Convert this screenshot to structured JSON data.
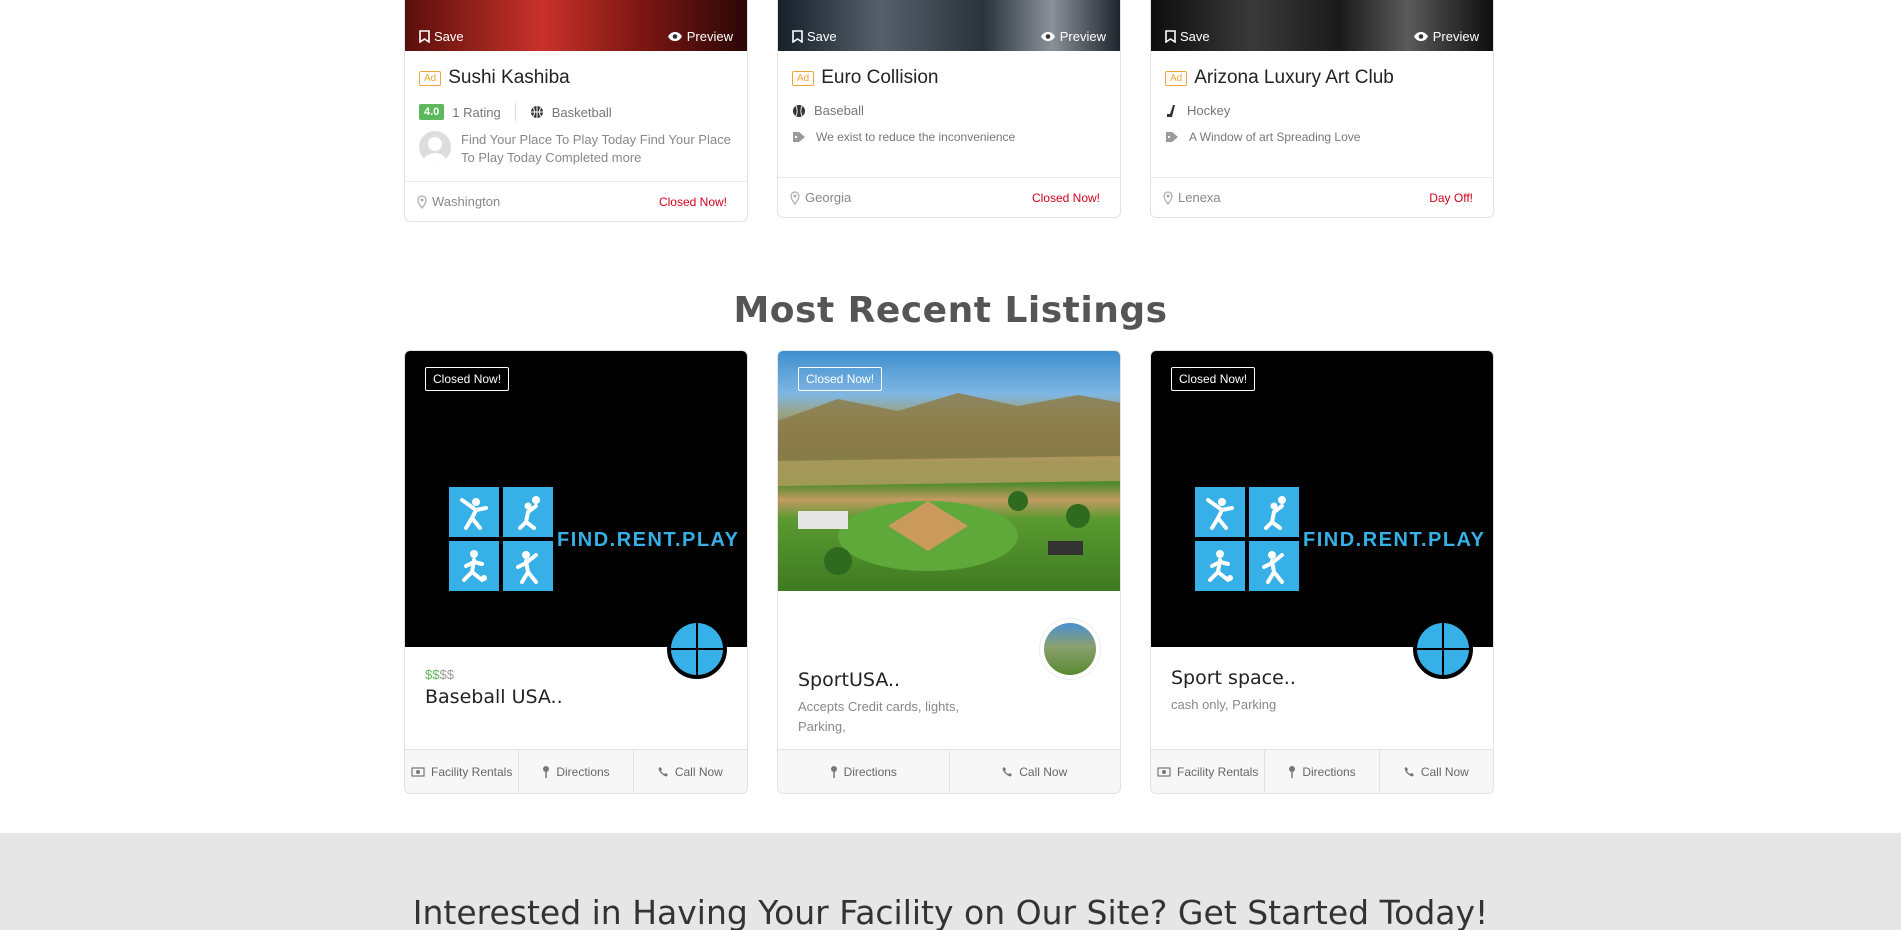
{
  "featured": [
    {
      "save_label": "Save",
      "preview_label": "Preview",
      "ad": "Ad",
      "title": "Sushi Kashiba",
      "rating": "4.0",
      "rating_count": "1 Rating",
      "category": "Basketball",
      "description": "Find Your Place To Play Today Find Your Place To Play Today Completed more",
      "location": "Washington",
      "status": "Closed Now!",
      "image_colors": [
        "#7a1612",
        "#c8322a"
      ]
    },
    {
      "save_label": "Save",
      "preview_label": "Preview",
      "ad": "Ad",
      "title": "Euro Collision",
      "category": "Baseball",
      "description": "We exist to reduce the inconvenience",
      "location": "Georgia",
      "status": "Closed Now!",
      "image_colors": [
        "#1c2630",
        "#6a7580"
      ]
    },
    {
      "save_label": "Save",
      "preview_label": "Preview",
      "ad": "Ad",
      "title": "Arizona Luxury Art Club",
      "category": "Hockey",
      "description": "A Window of art Spreading Love",
      "location": "Lenexa",
      "status": "Day Off!",
      "image_colors": [
        "#121212",
        "#4a4a4a"
      ]
    }
  ],
  "section_title": "Most Recent Listings",
  "recent": [
    {
      "badge": "Closed Now!",
      "logo_text": "FIND.RENT.PLAY",
      "price_active": "$$",
      "price_inactive": "$$",
      "title": "Baseball USA..",
      "tags": "",
      "actions": [
        "Facility Rentals",
        "Directions",
        "Call Now"
      ]
    },
    {
      "badge": "Closed Now!",
      "title": "SportUSA..",
      "tags": "Accepts Credit cards, lights, Parking,",
      "actions": [
        "Directions",
        "Call Now"
      ]
    },
    {
      "badge": "Closed Now!",
      "logo_text": "FIND.RENT.PLAY",
      "title": "Sport space..",
      "tags": "cash only, Parking",
      "actions": [
        "Facility Rentals",
        "Directions",
        "Call Now"
      ]
    }
  ],
  "banner_title": "Interested in Having Your Facility on Our Site? Get Started Today!",
  "colors": {
    "accent": "#36b0e6",
    "rating": "#5cb85c",
    "closed": "#d0021b",
    "ad": "#f0a33a"
  }
}
